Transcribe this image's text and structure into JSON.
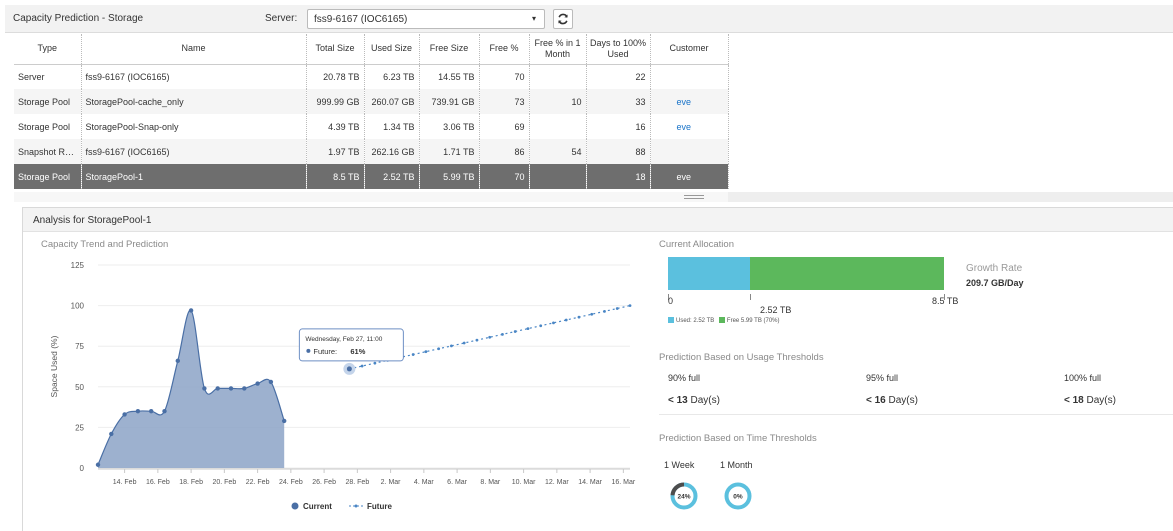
{
  "header": {
    "title": "Capacity Prediction - Storage",
    "server_label": "Server:",
    "server_value": "fss9-6167 (IOC6165)",
    "dropdown_caret": "▾"
  },
  "table": {
    "columns": [
      "Type",
      "Name",
      "Total Size",
      "Used Size",
      "Free Size",
      "Free %",
      "Free % in 1 Month",
      "Days to 100% Used",
      "Customer"
    ],
    "rows": [
      {
        "type": "Server",
        "name": "fss9-6167 (IOC6165)",
        "total": "20.78 TB",
        "used": "6.23 TB",
        "free": "14.55 TB",
        "free_pct": "70",
        "free_1m": "",
        "days": "22",
        "customer": ""
      },
      {
        "type": "Storage Pool",
        "name": "StoragePool-cache_only",
        "total": "999.99 GB",
        "used": "260.07 GB",
        "free": "739.91 GB",
        "free_pct": "73",
        "free_1m": "10",
        "days": "33",
        "customer": "eve"
      },
      {
        "type": "Storage Pool",
        "name": "StoragePool-Snap-only",
        "total": "4.39 TB",
        "used": "1.34 TB",
        "free": "3.06 TB",
        "free_pct": "69",
        "free_1m": "",
        "days": "16",
        "customer": "eve"
      },
      {
        "type": "Snapshot Reso...",
        "name": "fss9-6167 (IOC6165)",
        "total": "1.97 TB",
        "used": "262.16 GB",
        "free": "1.71 TB",
        "free_pct": "86",
        "free_1m": "54",
        "days": "88",
        "customer": ""
      },
      {
        "type": "Storage Pool",
        "name": "StoragePool-1",
        "total": "8.5 TB",
        "used": "2.52 TB",
        "free": "5.99 TB",
        "free_pct": "70",
        "free_1m": "",
        "days": "18",
        "customer": "eve",
        "selected": true
      }
    ]
  },
  "analysis": {
    "title": "Analysis for StoragePool-1",
    "trend_title": "Capacity Trend and Prediction",
    "allocation_title": "Current Allocation",
    "growth_label": "Growth Rate",
    "growth_value": "209.7 GB/Day",
    "alloc_min_label": "0",
    "alloc_used_label": "2.52 TB",
    "alloc_max_label": "8.5 TB",
    "legend_used": "Used: 2.52 TB",
    "legend_free": "Free 5.99 TB (70%)",
    "alloc_used_tb": 2.52,
    "alloc_total_tb": 8.5,
    "usage_title": "Prediction Based on Usage Thresholds",
    "thresholds": [
      {
        "label": "90% full",
        "prefix": "< ",
        "days": "13",
        "unit": " Day(s)"
      },
      {
        "label": "95% full",
        "prefix": "< ",
        "days": "16",
        "unit": " Day(s)"
      },
      {
        "label": "100% full",
        "prefix": "< ",
        "days": "18",
        "unit": " Day(s)"
      }
    ],
    "time_title": "Prediction Based on Time Thresholds",
    "periods": [
      {
        "label": "1 Week",
        "pct_label": "24%",
        "pct": 24
      },
      {
        "label": "1 Month",
        "pct_label": "0%",
        "pct": 0
      }
    ]
  },
  "colors": {
    "used": "#5bc0de",
    "free": "#5cb85c",
    "area": "#8ca3c7",
    "area_line": "#4a6fa5",
    "future": "#4a86c5",
    "selected_row": "#6e6e6e",
    "link": "#1a74c9"
  },
  "chart_data": {
    "type": "area",
    "ylabel": "Space Used (%)",
    "xlabel": "",
    "ylim": [
      0,
      125
    ],
    "yticks": [
      0,
      25,
      50,
      75,
      100,
      125
    ],
    "xtick_labels": [
      "14. Feb",
      "16. Feb",
      "18. Feb",
      "20. Feb",
      "22. Feb",
      "24. Feb",
      "26. Feb",
      "28. Feb",
      "2. Mar",
      "4. Mar",
      "6. Mar",
      "8. Mar",
      "10. Mar",
      "12. Mar",
      "14. Mar",
      "16. Mar"
    ],
    "series": [
      {
        "name": "Current",
        "x": [
          0,
          1,
          2,
          3,
          4,
          5,
          6,
          7,
          8,
          9,
          10,
          11,
          12,
          13,
          14,
          15
        ],
        "values": [
          2,
          21,
          33,
          35,
          35,
          35,
          66,
          97,
          49,
          49,
          49,
          49,
          52,
          53,
          29,
          null
        ]
      },
      {
        "name": "Future",
        "x_start": 18.9,
        "x_end": 40,
        "y_start": 61,
        "y_end": 100
      }
    ],
    "tooltip": {
      "date": "Wednesday, Feb 27, 11:00",
      "label": "Future: ",
      "value": "61%"
    },
    "legend": {
      "position": "bottom",
      "items": [
        "Current",
        "Future"
      ]
    }
  }
}
